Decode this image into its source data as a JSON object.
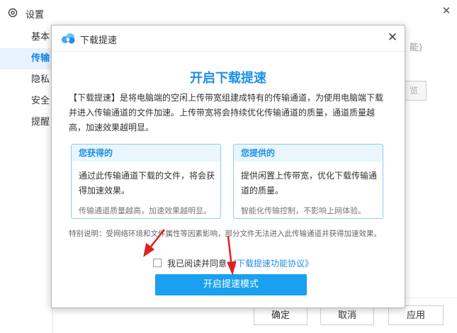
{
  "settings": {
    "title": "设置",
    "close": "✕",
    "nav": [
      {
        "label": "基本"
      },
      {
        "label": "传输"
      },
      {
        "label": "隐私"
      },
      {
        "label": "安全"
      },
      {
        "label": "提醒"
      }
    ],
    "hint_text": "能)",
    "browse_label": "览",
    "footer": {
      "ok": "确定",
      "cancel": "取消",
      "apply": "应用"
    }
  },
  "dialog": {
    "title": "下载提速",
    "close": "✕",
    "heading": "开启下载提速",
    "description": "【下载提速】是将电脑端的空闲上传带宽组建成特有的传输通道，为使用电脑端下载并进入传输通道的文件加速。上传带宽将会持续优化传输通道的质量，通道质量越高，加速效果越明显。",
    "cards": [
      {
        "title": "您获得的",
        "body": "通过此传输通道下载的文件，将会获得加速效果。",
        "note": "传输通道质量越高，加速效果越明显。"
      },
      {
        "title": "您提供的",
        "body": "提供闲置上传带宽，优化下载传输通道的质量。",
        "note": "智能化传输控制，不影响上网体验。"
      }
    ],
    "special_note": "特别说明：受网络环境和文件属性等因素影响，部分文件无法进入此传输通道并获得加速效果。",
    "agree_text": "我已阅读并同意",
    "agree_link": "《下载提速功能协议》",
    "primary_button": "开启提速模式"
  },
  "colors": {
    "accent": "#1e8fe6",
    "button": "#1aa0f0",
    "arrow": "#e02020"
  }
}
